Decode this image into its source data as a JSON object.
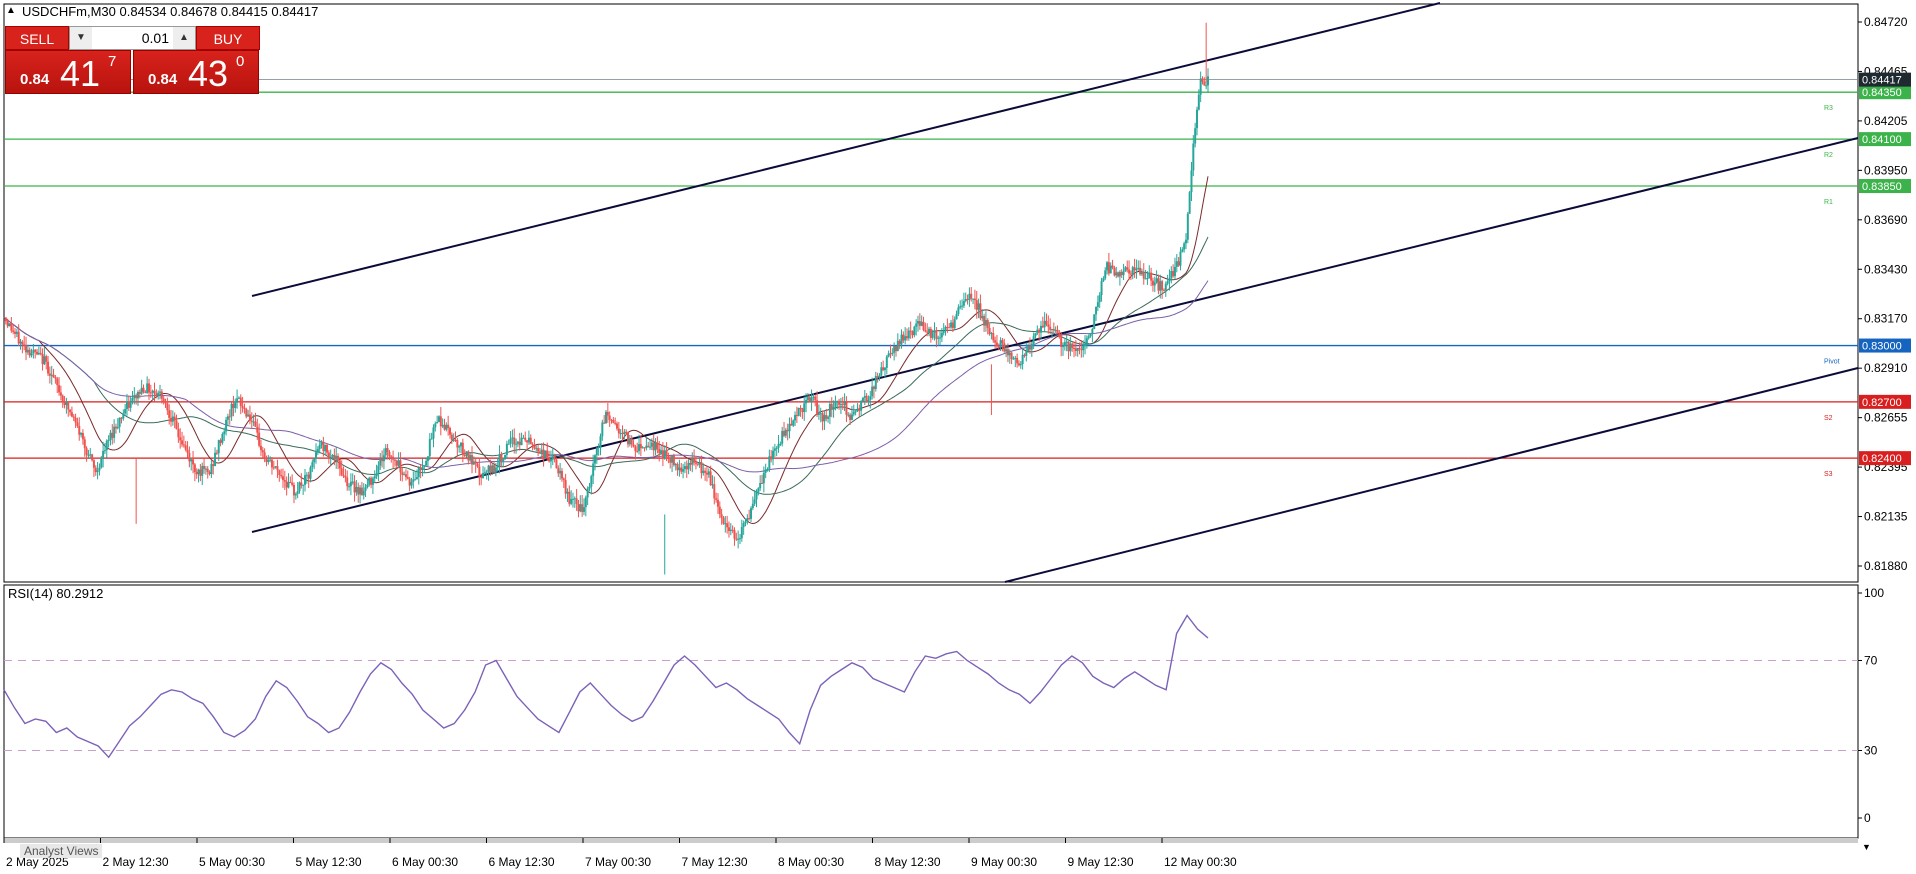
{
  "header": {
    "symbol": "USDCHFm,M30",
    "ohlc": "0.84534 0.84678 0.84415 0.84417"
  },
  "trade_panel": {
    "sell_label": "SELL",
    "buy_label": "BUY",
    "lot": "0.01",
    "sell_prefix": "0.84",
    "sell_big": "41",
    "sell_sup": "7",
    "buy_prefix": "0.84",
    "buy_big": "43",
    "buy_sup": "0"
  },
  "rsi_label": "RSI(14) 80.2912",
  "analyst_label": "Analyst Views",
  "colors": {
    "bull": "#26a69a",
    "bear": "#ef5350",
    "resistance": "#3cb34a",
    "support": "#d81e1e",
    "pivot": "#1565c0",
    "channel": "#0b0b3a",
    "rsi": "#7b62b8",
    "current_price_bg": "#1e2a30"
  },
  "chart_data": [
    {
      "type": "candlestick",
      "y_ticks": [
        "0.84720",
        "0.84465",
        "0.84205",
        "0.83950",
        "0.83690",
        "0.83430",
        "0.83170",
        "0.82910",
        "0.82655",
        "0.82395",
        "0.82135",
        "0.81880"
      ],
      "ylim": [
        0.8174,
        0.8482
      ],
      "x_tick_labels": [
        "2 May 2025",
        "2 May 12:30",
        "5 May 00:30",
        "5 May 12:30",
        "6 May 00:30",
        "6 May 12:30",
        "7 May 00:30",
        "7 May 12:30",
        "8 May 00:30",
        "8 May 12:30",
        "9 May 00:30",
        "9 May 12:30",
        "12 May 00:30"
      ],
      "current_price": "0.84417",
      "levels": [
        {
          "value": 0.8435,
          "label": "0.84350",
          "tag": "R3",
          "kind": "resistance"
        },
        {
          "value": 0.841,
          "label": "0.84100",
          "tag": "R2",
          "kind": "resistance"
        },
        {
          "value": 0.8385,
          "label": "0.83850",
          "tag": "R1",
          "kind": "resistance"
        },
        {
          "value": 0.83,
          "label": "0.83000",
          "tag": "Pivot",
          "kind": "pivot"
        },
        {
          "value": 0.827,
          "label": "0.82700",
          "tag": "S2",
          "kind": "support"
        },
        {
          "value": 0.824,
          "label": "0.82400",
          "tag": "S3",
          "kind": "support"
        }
      ],
      "close_path": [
        [
          0,
          0.8315
        ],
        [
          10,
          0.83
        ],
        [
          22,
          0.8292
        ],
        [
          32,
          0.8272
        ],
        [
          42,
          0.8252
        ],
        [
          50,
          0.8232
        ],
        [
          58,
          0.8252
        ],
        [
          66,
          0.8266
        ],
        [
          76,
          0.8278
        ],
        [
          86,
          0.8274
        ],
        [
          96,
          0.825
        ],
        [
          104,
          0.8234
        ],
        [
          112,
          0.8232
        ],
        [
          120,
          0.8256
        ],
        [
          126,
          0.8272
        ],
        [
          134,
          0.8262
        ],
        [
          142,
          0.824
        ],
        [
          150,
          0.8232
        ],
        [
          158,
          0.8222
        ],
        [
          166,
          0.823
        ],
        [
          172,
          0.8248
        ],
        [
          180,
          0.824
        ],
        [
          188,
          0.8226
        ],
        [
          196,
          0.8222
        ],
        [
          202,
          0.8232
        ],
        [
          208,
          0.8244
        ],
        [
          214,
          0.8238
        ],
        [
          222,
          0.8226
        ],
        [
          230,
          0.824
        ],
        [
          236,
          0.8262
        ],
        [
          244,
          0.8252
        ],
        [
          252,
          0.8242
        ],
        [
          260,
          0.823
        ],
        [
          268,
          0.8236
        ],
        [
          276,
          0.8248
        ],
        [
          284,
          0.825
        ],
        [
          292,
          0.8244
        ],
        [
          300,
          0.8238
        ],
        [
          308,
          0.8218
        ],
        [
          316,
          0.8212
        ],
        [
          322,
          0.824
        ],
        [
          328,
          0.8264
        ],
        [
          336,
          0.8254
        ],
        [
          344,
          0.8246
        ],
        [
          352,
          0.8248
        ],
        [
          360,
          0.8242
        ],
        [
          368,
          0.8235
        ],
        [
          376,
          0.8238
        ],
        [
          384,
          0.823
        ],
        [
          392,
          0.8205
        ],
        [
          400,
          0.8198
        ],
        [
          408,
          0.8214
        ],
        [
          416,
          0.8236
        ],
        [
          424,
          0.8252
        ],
        [
          432,
          0.8264
        ],
        [
          440,
          0.8272
        ],
        [
          446,
          0.826
        ],
        [
          454,
          0.8272
        ],
        [
          462,
          0.8262
        ],
        [
          470,
          0.8272
        ],
        [
          480,
          0.829
        ],
        [
          490,
          0.8305
        ],
        [
          500,
          0.8312
        ],
        [
          508,
          0.8304
        ],
        [
          516,
          0.831
        ],
        [
          524,
          0.8326
        ],
        [
          530,
          0.8322
        ],
        [
          538,
          0.8304
        ],
        [
          546,
          0.8298
        ],
        [
          552,
          0.829
        ],
        [
          560,
          0.8302
        ],
        [
          568,
          0.8312
        ],
        [
          576,
          0.8302
        ],
        [
          584,
          0.8296
        ],
        [
          592,
          0.8306
        ],
        [
          600,
          0.8342
        ],
        [
          608,
          0.8338
        ],
        [
          616,
          0.834
        ],
        [
          624,
          0.8336
        ],
        [
          632,
          0.833
        ],
        [
          640,
          0.8345
        ],
        [
          644,
          0.8355
        ],
        [
          648,
          0.8408
        ],
        [
          652,
          0.844
        ],
        [
          656,
          0.8442
        ]
      ],
      "wick_extremes": [
        0.8205,
        0.8178,
        0.8263,
        0.8472
      ]
    },
    {
      "type": "line",
      "ylim": [
        0,
        100
      ],
      "y_ticks": [
        "100",
        "70",
        "30",
        "0"
      ],
      "guide_levels": [
        70,
        30
      ],
      "values": [
        57,
        49,
        42,
        44,
        43,
        38,
        40,
        36,
        34,
        32,
        27,
        34,
        41,
        45,
        50,
        55,
        57,
        56,
        53,
        51,
        45,
        38,
        36,
        39,
        44,
        54,
        61,
        58,
        52,
        45,
        42,
        38,
        40,
        47,
        56,
        64,
        69,
        66,
        60,
        55,
        48,
        44,
        40,
        42,
        48,
        56,
        68,
        70,
        62,
        54,
        49,
        44,
        41,
        38,
        47,
        56,
        60,
        55,
        50,
        46,
        43,
        45,
        52,
        60,
        68,
        72,
        68,
        63,
        58,
        60,
        57,
        53,
        50,
        47,
        44,
        38,
        33,
        48,
        59,
        63,
        66,
        69,
        67,
        62,
        60,
        58,
        56,
        65,
        72,
        71,
        73,
        74,
        70,
        67,
        64,
        60,
        57,
        55,
        51,
        56,
        62,
        68,
        72,
        69,
        63,
        60,
        58,
        62,
        65,
        62,
        59,
        57,
        82,
        90,
        84,
        80
      ]
    }
  ]
}
